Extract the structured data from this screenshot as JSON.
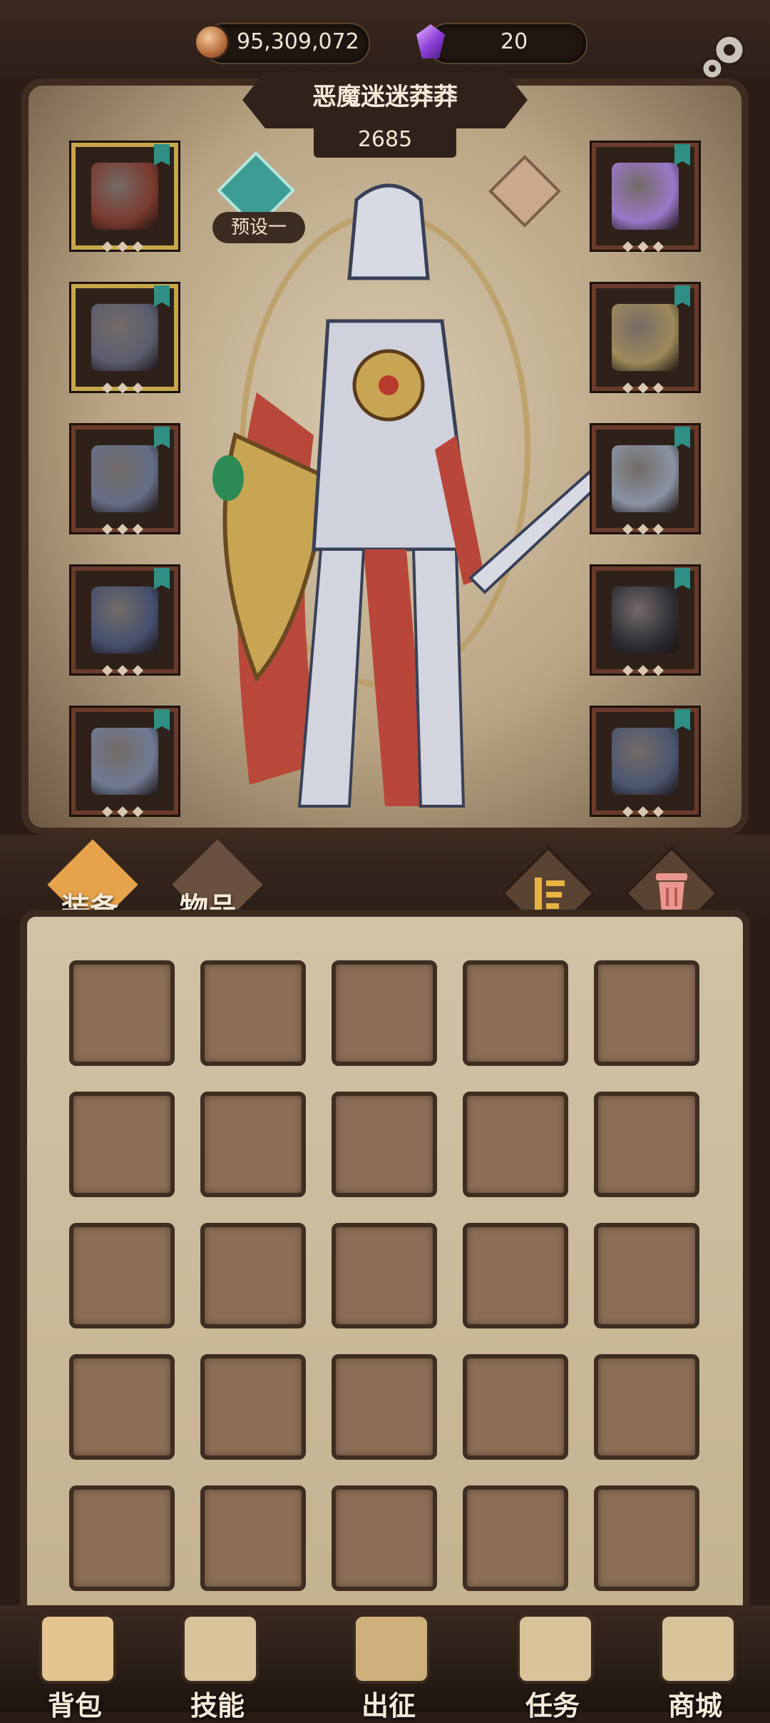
{
  "resources": {
    "gold": "95,309,072",
    "gems": "20",
    "gold_icon": "coin-icon",
    "gem_icon": "purple-crystal-icon"
  },
  "hero": {
    "name": "恶魔迷迷莽莽",
    "power": "2685",
    "preset_label": "预设一"
  },
  "equipment": {
    "left": [
      {
        "slot": "helmet",
        "gold": true,
        "color": "#7a3a2e"
      },
      {
        "slot": "armor",
        "gold": true,
        "color": "#5a5d6e"
      },
      {
        "slot": "gauntlets",
        "gold": false,
        "color": "#646e86"
      },
      {
        "slot": "pants",
        "gold": false,
        "color": "#44506e"
      },
      {
        "slot": "boots",
        "gold": false,
        "color": "#6f7a93"
      }
    ],
    "right": [
      {
        "slot": "necklace",
        "gold": false,
        "color": "#9b78c9"
      },
      {
        "slot": "amulet",
        "gold": false,
        "color": "#9e8a5a"
      },
      {
        "slot": "ring",
        "gold": false,
        "color": "#8a93a3"
      },
      {
        "slot": "weapon",
        "gold": false,
        "color": "#2e2e35"
      },
      {
        "slot": "shield",
        "gold": false,
        "color": "#4c5670"
      }
    ]
  },
  "tabs": [
    {
      "label": "装备",
      "active": true
    },
    {
      "label": "物品",
      "active": false
    }
  ],
  "tools": [
    "sort-icon",
    "trash-icon"
  ],
  "inventory": {
    "rows": 5,
    "cols": 5
  },
  "nav": [
    {
      "label": "背包",
      "icon": "backpack-icon"
    },
    {
      "label": "技能",
      "icon": "skill-scroll-icon"
    },
    {
      "label": "出征",
      "icon": "expedition-map-icon"
    },
    {
      "label": "任务",
      "icon": "quest-scroll-icon"
    },
    {
      "label": "商城",
      "icon": "shop-crown-icon"
    }
  ]
}
